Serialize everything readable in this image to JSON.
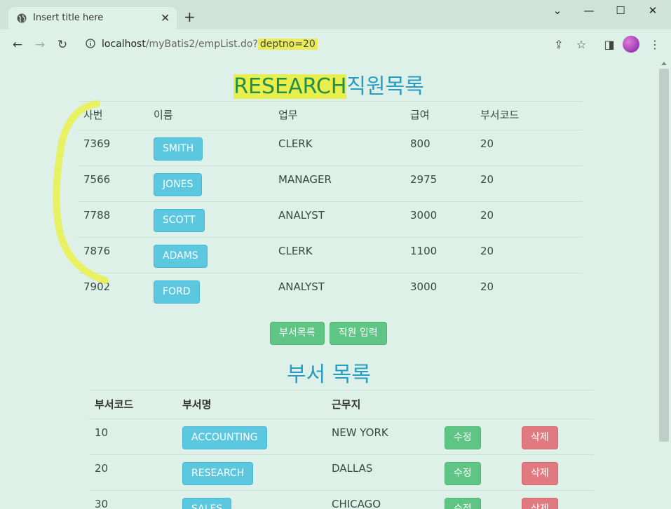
{
  "browser": {
    "tab_title": "Insert title here",
    "url_host": "localhost",
    "url_path": "/myBatis2/empList.do?",
    "url_query": "deptno=20"
  },
  "emp": {
    "title_hl": "RESEARCH",
    "title_rest": "직원목록",
    "headers": [
      "사번",
      "이름",
      "업무",
      "급여",
      "부서코드"
    ],
    "rows": [
      {
        "empno": "7369",
        "ename": "SMITH",
        "job": "CLERK",
        "sal": "800",
        "deptno": "20"
      },
      {
        "empno": "7566",
        "ename": "JONES",
        "job": "MANAGER",
        "sal": "2975",
        "deptno": "20"
      },
      {
        "empno": "7788",
        "ename": "SCOTT",
        "job": "ANALYST",
        "sal": "3000",
        "deptno": "20"
      },
      {
        "empno": "7876",
        "ename": "ADAMS",
        "job": "CLERK",
        "sal": "1100",
        "deptno": "20"
      },
      {
        "empno": "7902",
        "ename": "FORD",
        "job": "ANALYST",
        "sal": "3000",
        "deptno": "20"
      }
    ]
  },
  "actions": {
    "dept_list": "부서목록",
    "emp_insert": "직원 입력"
  },
  "dept": {
    "title": "부서 목록",
    "headers": [
      "부서코드",
      "부서명",
      "근무지"
    ],
    "rows": [
      {
        "deptno": "10",
        "dname": "ACCOUNTING",
        "loc": "NEW YORK",
        "edit": "수정",
        "delete": "삭제"
      },
      {
        "deptno": "20",
        "dname": "RESEARCH",
        "loc": "DALLAS",
        "edit": "수정",
        "delete": "삭제"
      },
      {
        "deptno": "30",
        "dname": "SALES",
        "loc": "CHICAGO",
        "edit": "수정",
        "delete": "삭제"
      }
    ]
  },
  "colors": {
    "highlight": "#e8ee4c",
    "title_blue": "#2a9cc4",
    "info": "#5bc8e0",
    "success": "#5fc584",
    "danger": "#e07a80"
  }
}
